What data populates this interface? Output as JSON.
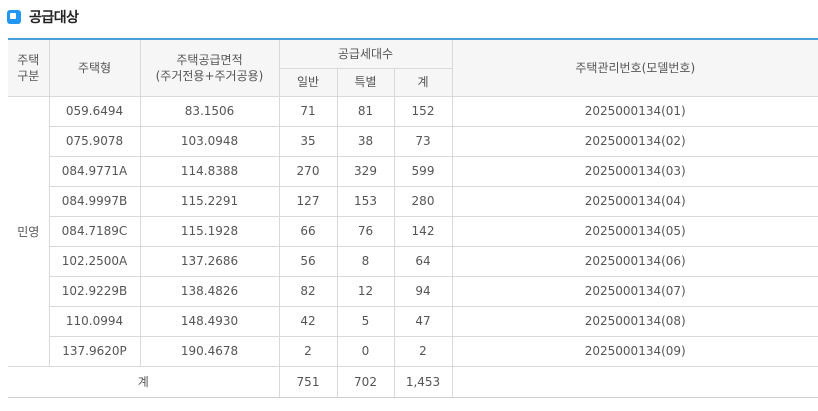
{
  "section": {
    "title": "공급대상"
  },
  "table": {
    "headers": {
      "category_line1": "주택",
      "category_line2": "구분",
      "housing_type": "주택형",
      "area_line1": "주택공급면적",
      "area_line2": "(주거전용+주거공용)",
      "households": "공급세대수",
      "general": "일반",
      "special": "특별",
      "total": "계",
      "mgmt_no": "주택관리번호(모델번호)"
    },
    "category": "민영",
    "rows": [
      {
        "type": "059.6494",
        "area": "83.1506",
        "general": "71",
        "special": "81",
        "total": "152",
        "mgmt": "2025000134(01)"
      },
      {
        "type": "075.9078",
        "area": "103.0948",
        "general": "35",
        "special": "38",
        "total": "73",
        "mgmt": "2025000134(02)"
      },
      {
        "type": "084.9771A",
        "area": "114.8388",
        "general": "270",
        "special": "329",
        "total": "599",
        "mgmt": "2025000134(03)"
      },
      {
        "type": "084.9997B",
        "area": "115.2291",
        "general": "127",
        "special": "153",
        "total": "280",
        "mgmt": "2025000134(04)"
      },
      {
        "type": "084.7189C",
        "area": "115.1928",
        "general": "66",
        "special": "76",
        "total": "142",
        "mgmt": "2025000134(05)"
      },
      {
        "type": "102.2500A",
        "area": "137.2686",
        "general": "56",
        "special": "8",
        "total": "64",
        "mgmt": "2025000134(06)"
      },
      {
        "type": "102.9229B",
        "area": "138.4826",
        "general": "82",
        "special": "12",
        "total": "94",
        "mgmt": "2025000134(07)"
      },
      {
        "type": "110.0994",
        "area": "148.4930",
        "general": "42",
        "special": "5",
        "total": "47",
        "mgmt": "2025000134(08)"
      },
      {
        "type": "137.9620P",
        "area": "190.4678",
        "general": "2",
        "special": "0",
        "total": "2",
        "mgmt": "2025000134(09)"
      }
    ],
    "totals": {
      "label": "계",
      "general": "751",
      "special": "702",
      "total": "1,453"
    }
  },
  "colors": {
    "accent": "#2196f3",
    "table_top_border": "#4a9fd8",
    "header_bg": "#f6f6f6",
    "grid": "#d9d9d9"
  }
}
